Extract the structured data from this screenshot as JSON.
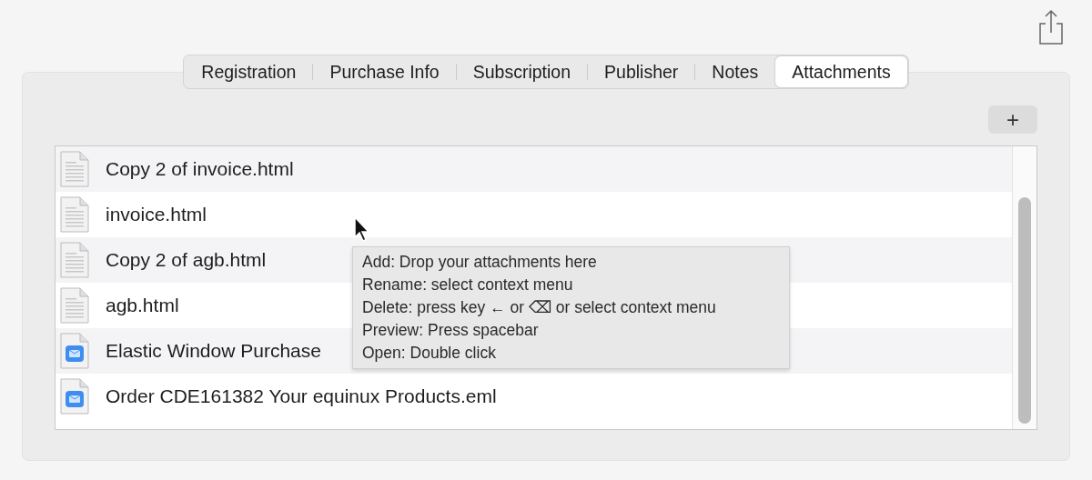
{
  "tabs": [
    {
      "label": "Registration",
      "selected": false
    },
    {
      "label": "Purchase Info",
      "selected": false
    },
    {
      "label": "Subscription",
      "selected": false
    },
    {
      "label": "Publisher",
      "selected": false
    },
    {
      "label": "Notes",
      "selected": false
    },
    {
      "label": "Attachments",
      "selected": true
    }
  ],
  "add_button": {
    "label": "+"
  },
  "attachments": [
    {
      "name": "Copy 2 of invoice.html",
      "kind": "html"
    },
    {
      "name": "invoice.html",
      "kind": "html"
    },
    {
      "name": "Copy 2 of agb.html",
      "kind": "html"
    },
    {
      "name": "agb.html",
      "kind": "html"
    },
    {
      "name": "Elastic Window Purchase",
      "kind": "mail"
    },
    {
      "name": "Order CDE161382 Your equinux Products.eml",
      "kind": "mail"
    }
  ],
  "tooltip": {
    "lines": [
      "Add: Drop your attachments here",
      "Rename: select context menu",
      "Delete: press key ← or ⌫ or select context menu",
      "Preview: Press spacebar",
      "Open: Double click"
    ]
  }
}
